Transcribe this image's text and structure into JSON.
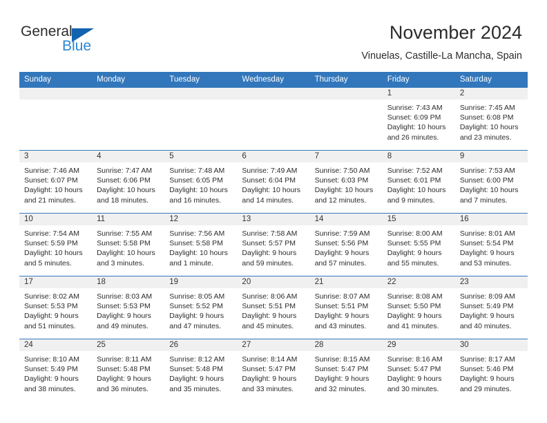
{
  "logo": {
    "text_primary": "General",
    "text_secondary": "Blue",
    "triangle_color": "#1263b0",
    "secondary_color": "#2a86d4"
  },
  "header": {
    "title": "November 2024",
    "location": "Vinuelas, Castille-La Mancha, Spain"
  },
  "theme": {
    "header_blue": "#3277bb",
    "daynum_band": "#f0f0f0",
    "text": "#2b2b2b"
  },
  "calendar": {
    "weekday_headers": [
      "Sunday",
      "Monday",
      "Tuesday",
      "Wednesday",
      "Thursday",
      "Friday",
      "Saturday"
    ],
    "labels": {
      "sunrise": "Sunrise:",
      "sunset": "Sunset:",
      "daylight": "Daylight:"
    },
    "weeks": [
      [
        {
          "day": "",
          "sunrise": "",
          "sunset": "",
          "daylight": ""
        },
        {
          "day": "",
          "sunrise": "",
          "sunset": "",
          "daylight": ""
        },
        {
          "day": "",
          "sunrise": "",
          "sunset": "",
          "daylight": ""
        },
        {
          "day": "",
          "sunrise": "",
          "sunset": "",
          "daylight": ""
        },
        {
          "day": "",
          "sunrise": "",
          "sunset": "",
          "daylight": ""
        },
        {
          "day": "1",
          "sunrise": "Sunrise: 7:43 AM",
          "sunset": "Sunset: 6:09 PM",
          "daylight": "Daylight: 10 hours and 26 minutes."
        },
        {
          "day": "2",
          "sunrise": "Sunrise: 7:45 AM",
          "sunset": "Sunset: 6:08 PM",
          "daylight": "Daylight: 10 hours and 23 minutes."
        }
      ],
      [
        {
          "day": "3",
          "sunrise": "Sunrise: 7:46 AM",
          "sunset": "Sunset: 6:07 PM",
          "daylight": "Daylight: 10 hours and 21 minutes."
        },
        {
          "day": "4",
          "sunrise": "Sunrise: 7:47 AM",
          "sunset": "Sunset: 6:06 PM",
          "daylight": "Daylight: 10 hours and 18 minutes."
        },
        {
          "day": "5",
          "sunrise": "Sunrise: 7:48 AM",
          "sunset": "Sunset: 6:05 PM",
          "daylight": "Daylight: 10 hours and 16 minutes."
        },
        {
          "day": "6",
          "sunrise": "Sunrise: 7:49 AM",
          "sunset": "Sunset: 6:04 PM",
          "daylight": "Daylight: 10 hours and 14 minutes."
        },
        {
          "day": "7",
          "sunrise": "Sunrise: 7:50 AM",
          "sunset": "Sunset: 6:03 PM",
          "daylight": "Daylight: 10 hours and 12 minutes."
        },
        {
          "day": "8",
          "sunrise": "Sunrise: 7:52 AM",
          "sunset": "Sunset: 6:01 PM",
          "daylight": "Daylight: 10 hours and 9 minutes."
        },
        {
          "day": "9",
          "sunrise": "Sunrise: 7:53 AM",
          "sunset": "Sunset: 6:00 PM",
          "daylight": "Daylight: 10 hours and 7 minutes."
        }
      ],
      [
        {
          "day": "10",
          "sunrise": "Sunrise: 7:54 AM",
          "sunset": "Sunset: 5:59 PM",
          "daylight": "Daylight: 10 hours and 5 minutes."
        },
        {
          "day": "11",
          "sunrise": "Sunrise: 7:55 AM",
          "sunset": "Sunset: 5:58 PM",
          "daylight": "Daylight: 10 hours and 3 minutes."
        },
        {
          "day": "12",
          "sunrise": "Sunrise: 7:56 AM",
          "sunset": "Sunset: 5:58 PM",
          "daylight": "Daylight: 10 hours and 1 minute."
        },
        {
          "day": "13",
          "sunrise": "Sunrise: 7:58 AM",
          "sunset": "Sunset: 5:57 PM",
          "daylight": "Daylight: 9 hours and 59 minutes."
        },
        {
          "day": "14",
          "sunrise": "Sunrise: 7:59 AM",
          "sunset": "Sunset: 5:56 PM",
          "daylight": "Daylight: 9 hours and 57 minutes."
        },
        {
          "day": "15",
          "sunrise": "Sunrise: 8:00 AM",
          "sunset": "Sunset: 5:55 PM",
          "daylight": "Daylight: 9 hours and 55 minutes."
        },
        {
          "day": "16",
          "sunrise": "Sunrise: 8:01 AM",
          "sunset": "Sunset: 5:54 PM",
          "daylight": "Daylight: 9 hours and 53 minutes."
        }
      ],
      [
        {
          "day": "17",
          "sunrise": "Sunrise: 8:02 AM",
          "sunset": "Sunset: 5:53 PM",
          "daylight": "Daylight: 9 hours and 51 minutes."
        },
        {
          "day": "18",
          "sunrise": "Sunrise: 8:03 AM",
          "sunset": "Sunset: 5:53 PM",
          "daylight": "Daylight: 9 hours and 49 minutes."
        },
        {
          "day": "19",
          "sunrise": "Sunrise: 8:05 AM",
          "sunset": "Sunset: 5:52 PM",
          "daylight": "Daylight: 9 hours and 47 minutes."
        },
        {
          "day": "20",
          "sunrise": "Sunrise: 8:06 AM",
          "sunset": "Sunset: 5:51 PM",
          "daylight": "Daylight: 9 hours and 45 minutes."
        },
        {
          "day": "21",
          "sunrise": "Sunrise: 8:07 AM",
          "sunset": "Sunset: 5:51 PM",
          "daylight": "Daylight: 9 hours and 43 minutes."
        },
        {
          "day": "22",
          "sunrise": "Sunrise: 8:08 AM",
          "sunset": "Sunset: 5:50 PM",
          "daylight": "Daylight: 9 hours and 41 minutes."
        },
        {
          "day": "23",
          "sunrise": "Sunrise: 8:09 AM",
          "sunset": "Sunset: 5:49 PM",
          "daylight": "Daylight: 9 hours and 40 minutes."
        }
      ],
      [
        {
          "day": "24",
          "sunrise": "Sunrise: 8:10 AM",
          "sunset": "Sunset: 5:49 PM",
          "daylight": "Daylight: 9 hours and 38 minutes."
        },
        {
          "day": "25",
          "sunrise": "Sunrise: 8:11 AM",
          "sunset": "Sunset: 5:48 PM",
          "daylight": "Daylight: 9 hours and 36 minutes."
        },
        {
          "day": "26",
          "sunrise": "Sunrise: 8:12 AM",
          "sunset": "Sunset: 5:48 PM",
          "daylight": "Daylight: 9 hours and 35 minutes."
        },
        {
          "day": "27",
          "sunrise": "Sunrise: 8:14 AM",
          "sunset": "Sunset: 5:47 PM",
          "daylight": "Daylight: 9 hours and 33 minutes."
        },
        {
          "day": "28",
          "sunrise": "Sunrise: 8:15 AM",
          "sunset": "Sunset: 5:47 PM",
          "daylight": "Daylight: 9 hours and 32 minutes."
        },
        {
          "day": "29",
          "sunrise": "Sunrise: 8:16 AM",
          "sunset": "Sunset: 5:47 PM",
          "daylight": "Daylight: 9 hours and 30 minutes."
        },
        {
          "day": "30",
          "sunrise": "Sunrise: 8:17 AM",
          "sunset": "Sunset: 5:46 PM",
          "daylight": "Daylight: 9 hours and 29 minutes."
        }
      ]
    ]
  }
}
